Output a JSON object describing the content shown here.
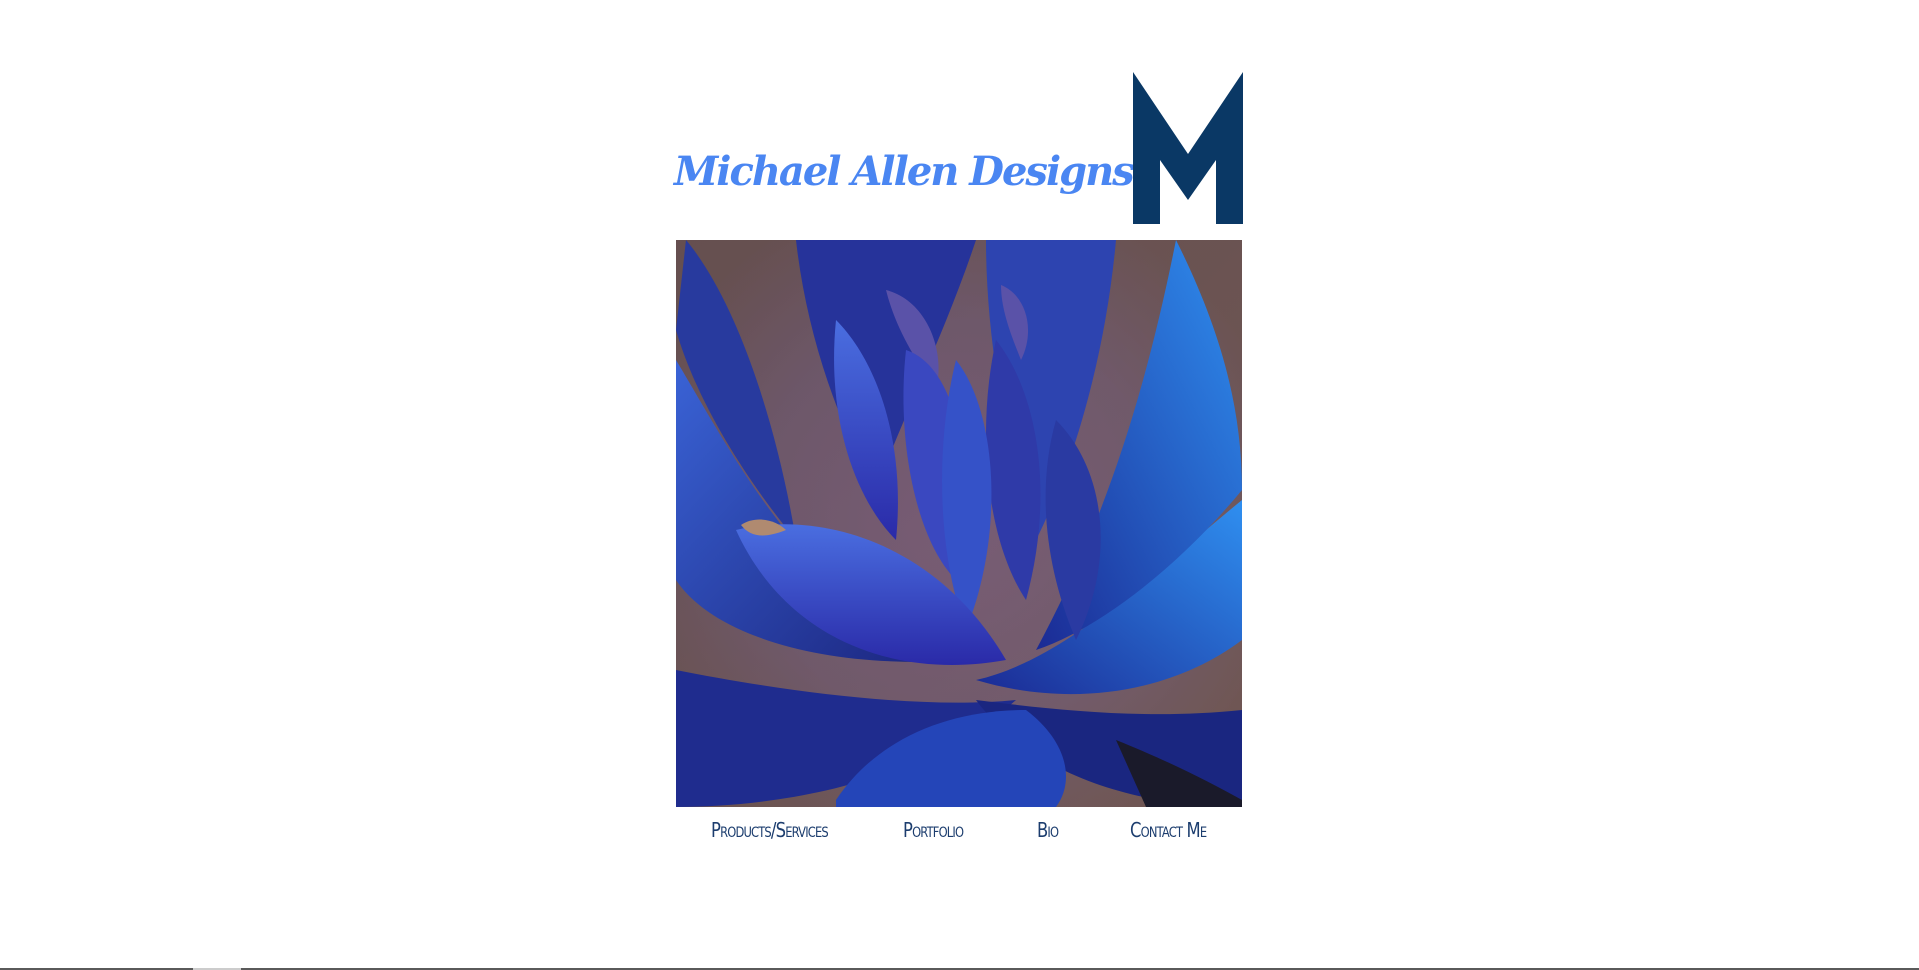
{
  "site": {
    "title": "Michael Allen Designs",
    "logo_letter": "M"
  },
  "hero": {
    "image_icon": "blue-metal-flower-sculpture-photo"
  },
  "nav": {
    "items": [
      {
        "label": "Products/Services"
      },
      {
        "label": "Portfolio"
      },
      {
        "label": "Bio"
      },
      {
        "label": "Contact Me"
      }
    ]
  },
  "colors": {
    "title": "#4a86f2",
    "logo": "#0a3865",
    "nav": "#1c3d6e",
    "background": "#ffffff"
  }
}
